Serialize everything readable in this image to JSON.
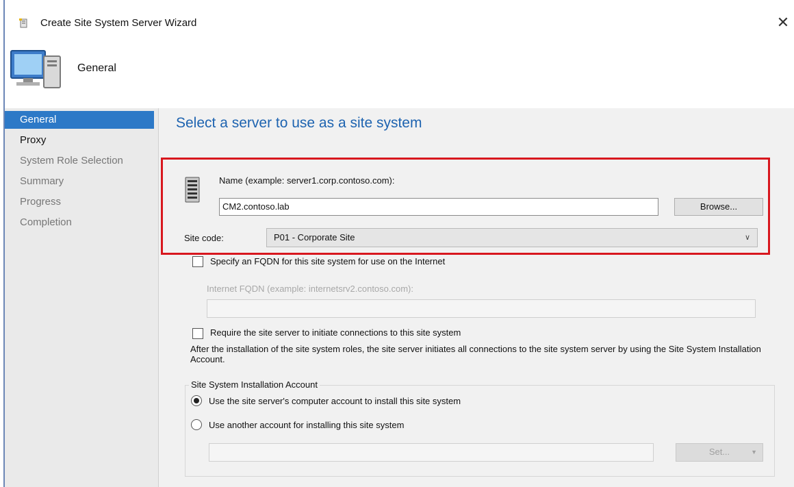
{
  "window": {
    "title": "Create Site System Server Wizard",
    "close_glyph": "✕",
    "header_title": "General"
  },
  "sidebar": {
    "items": [
      {
        "label": "General",
        "state": "active"
      },
      {
        "label": "Proxy",
        "state": "enabled"
      },
      {
        "label": "System Role Selection",
        "state": "disabled"
      },
      {
        "label": "Summary",
        "state": "disabled"
      },
      {
        "label": "Progress",
        "state": "disabled"
      },
      {
        "label": "Completion",
        "state": "disabled"
      }
    ]
  },
  "main": {
    "heading": "Select a server to use as a site system",
    "name_label": "Name (example: server1.corp.contoso.com):",
    "name_value": "CM2.contoso.lab",
    "browse_label": "Browse...",
    "site_code_label": "Site code:",
    "site_code_value": "P01 - Corporate Site",
    "fqdn_checkbox_label": "Specify an FQDN for this site system for use on the Internet",
    "fqdn_checked": false,
    "internet_fqdn_label": "Internet FQDN (example: internetsrv2.contoso.com):",
    "internet_fqdn_value": "",
    "require_checkbox_label": "Require the site server to initiate connections to this site system",
    "require_checked": false,
    "require_description": "After the  installation of the site system roles, the site server initiates all connections to the site system server by using the Site System Installation Account.",
    "account_group_label": "Site System Installation Account",
    "radio_computer_label": "Use the site server's computer account to install this site system",
    "radio_other_label": "Use another account for installing this site system",
    "selected_account_option": "computer",
    "account_value": "",
    "set_label": "Set...",
    "highlight_color": "#d8171e",
    "accent_color": "#2d79c7",
    "heading_color": "#1d63b0"
  }
}
